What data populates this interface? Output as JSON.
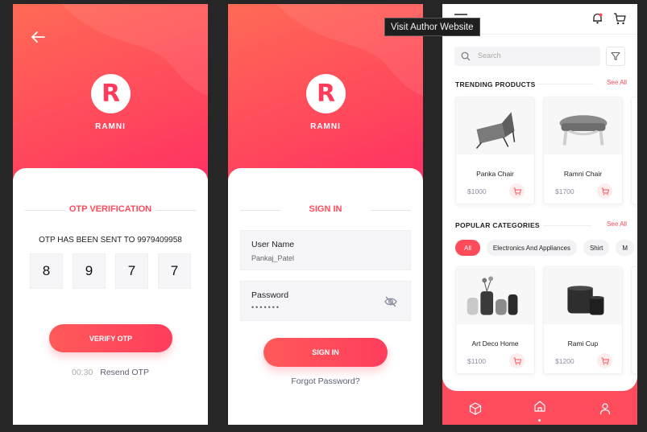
{
  "otp_screen": {
    "brand_initial": "R",
    "brand_name": "RAMNI",
    "title": "OTP VERIFICATION",
    "message": "OTP HAS BEEN SENT TO 9979409958",
    "digits": [
      "8",
      "9",
      "7",
      "7"
    ],
    "verify_label": "VERIFY OTP",
    "timer": "00:30",
    "resend_label": "Resend OTP"
  },
  "signin_screen": {
    "brand_initial": "R",
    "brand_name": "RAMNI",
    "title": "SIGN IN",
    "username_label": "User Name",
    "username_value": "Pankaj_Patel",
    "password_label": "Password",
    "password_value": "•••••••",
    "signin_label": "SIGN IN",
    "forgot_label": "Forgot Password?"
  },
  "shop_screen": {
    "search_placeholder": "Search",
    "trending_title": "TRENDING PRODUCTS",
    "trending_see_all": "See All",
    "trending": [
      {
        "name": "Panka Chair",
        "price": "$1000"
      },
      {
        "name": "Ramni Chair",
        "price": "$1700"
      }
    ],
    "categories_title": "POPULAR CATEGORIES",
    "categories_see_all": "See All",
    "categories": [
      "All",
      "Electronics And Appliances",
      "Shirt",
      "M"
    ],
    "popular": [
      {
        "name": "Art Deco Home",
        "price": "$1100"
      },
      {
        "name": "Rami Cup",
        "price": "$1200"
      }
    ]
  },
  "tooltip": "Visit Author Website",
  "colors": {
    "accent": "#ff4a5c",
    "accent_light": "#ff6a55",
    "background": "#262626"
  }
}
